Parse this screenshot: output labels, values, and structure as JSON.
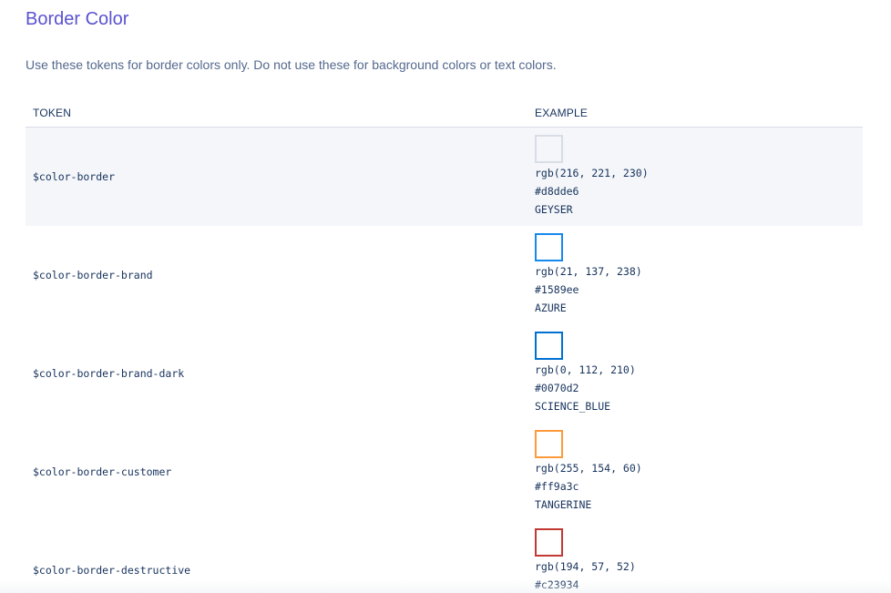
{
  "section": {
    "title": "Border Color",
    "description": "Use these tokens for border colors only. Do not use these for background colors or text colors."
  },
  "table": {
    "headers": {
      "token": "TOKEN",
      "example": "EXAMPLE"
    },
    "rows": [
      {
        "token": "$color-border",
        "rgb": "rgb(216, 221, 230)",
        "hex": "#d8dde6",
        "name": "GEYSER",
        "color": "#d8dde6"
      },
      {
        "token": "$color-border-brand",
        "rgb": "rgb(21, 137, 238)",
        "hex": "#1589ee",
        "name": "AZURE",
        "color": "#1589ee"
      },
      {
        "token": "$color-border-brand-dark",
        "rgb": "rgb(0, 112, 210)",
        "hex": "#0070d2",
        "name": "SCIENCE_BLUE",
        "color": "#0070d2"
      },
      {
        "token": "$color-border-customer",
        "rgb": "rgb(255, 154, 60)",
        "hex": "#ff9a3c",
        "name": "TANGERINE",
        "color": "#ff9a3c"
      },
      {
        "token": "$color-border-destructive",
        "rgb": "rgb(194, 57, 52)",
        "hex": "#c23934",
        "name": "",
        "color": "#c23934"
      }
    ]
  }
}
